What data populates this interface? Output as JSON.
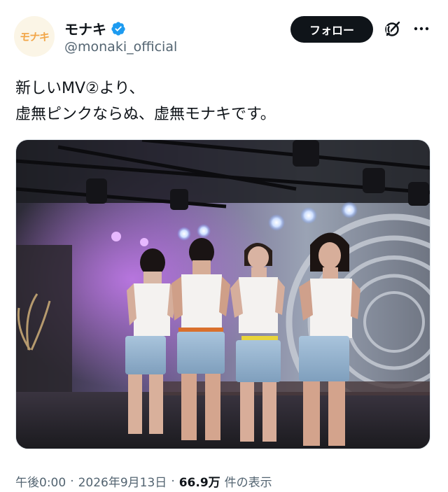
{
  "tweet": {
    "author": {
      "display_name": "モナキ",
      "handle": "@monaki_official",
      "avatar_text": "モナキ",
      "verified": true,
      "verified_color": "#1d9bf0"
    },
    "follow_label": "フォロー",
    "text": "新しいMV②より、\n虚無ピンクならぬ、虚無モナキです。",
    "image_alt": "stage photo of four performers in white tank tops and denim shorts",
    "meta": {
      "time": "午後0:00",
      "separator": "·",
      "date": "2026年9月13日",
      "views_count": "66.9万",
      "views_label": "件の表示"
    }
  },
  "icons": [
    "verified-badge-icon",
    "grok-icon",
    "more-icon"
  ]
}
